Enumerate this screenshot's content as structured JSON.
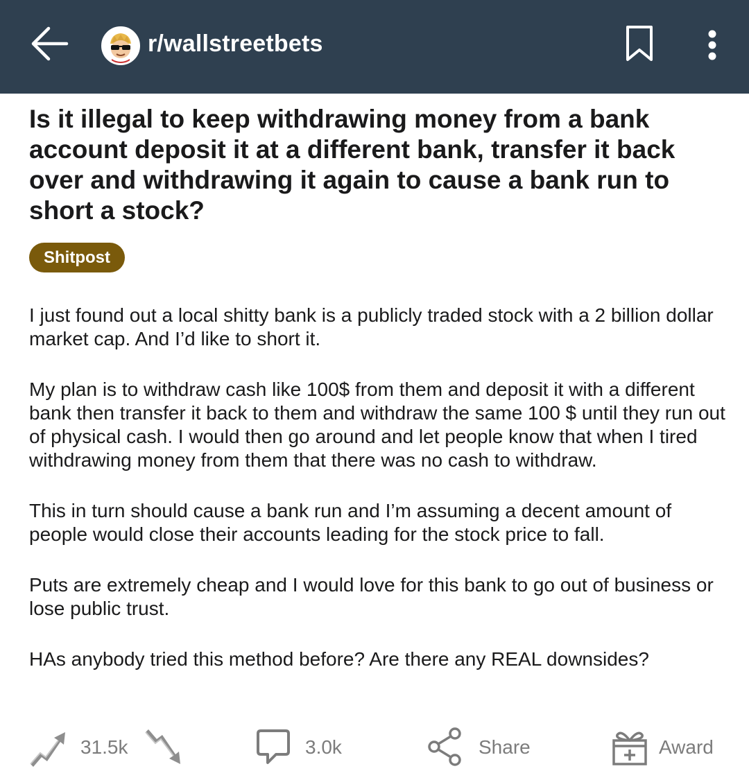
{
  "header": {
    "subreddit": "r/wallstreetbets",
    "colors": {
      "bar": "#2f4050",
      "icons": "#ffffff"
    }
  },
  "post": {
    "title": "Is it illegal to keep withdrawing money from a bank account deposit it at a different bank, transfer it back over and withdrawing it again to cause a bank run to short a stock?",
    "flair": "Shitpost",
    "flair_color": "#7a5a0b",
    "paragraphs": [
      "I just found out a local shitty bank is a publicly traded stock with a 2 billion dollar market cap. And I’d like to short it.",
      "My plan is to withdraw cash like 100$ from them and deposit it with a different bank then transfer it back to them and withdraw the same 100 $ until they run out of physical cash. I would then go around and let people know that when I tired withdrawing money from them that there was no cash to withdraw.",
      "This in turn should cause a bank run and I’m assuming a decent amount of people would close their accounts leading for the stock price to fall.",
      "Puts are extremely cheap and I would love for this bank to go out of business or lose public trust.",
      "HAs anybody tried this method before?  Are there any REAL downsides?"
    ]
  },
  "actions": {
    "votes": "31.5k",
    "comments": "3.0k",
    "share": "Share",
    "award": "Award"
  },
  "icons": [
    "back-arrow-icon",
    "subreddit-avatar-icon",
    "bookmark-icon",
    "more-vertical-icon",
    "upvote-icon",
    "downvote-icon",
    "comment-icon",
    "share-icon",
    "award-icon"
  ]
}
